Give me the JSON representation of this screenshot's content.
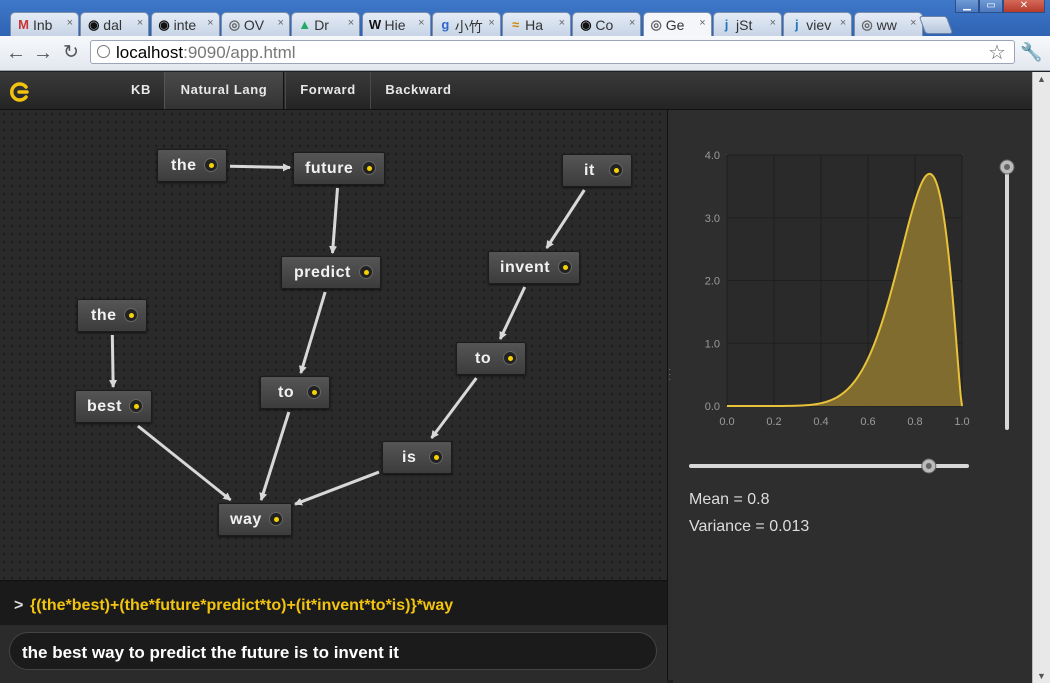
{
  "browser": {
    "tabs": [
      {
        "label": "Inb",
        "icon": "M",
        "color": "#c33"
      },
      {
        "label": "dal",
        "icon": "◉",
        "color": "#111"
      },
      {
        "label": "inte",
        "icon": "◉",
        "color": "#111"
      },
      {
        "label": "OV",
        "icon": "◎",
        "color": "#666"
      },
      {
        "label": "Dr",
        "icon": "▲",
        "color": "#2a6"
      },
      {
        "label": "Hie",
        "icon": "W",
        "color": "#111"
      },
      {
        "label": "小竹",
        "icon": "g",
        "color": "#36c"
      },
      {
        "label": "Ha",
        "icon": "≈",
        "color": "#c80"
      },
      {
        "label": "Co",
        "icon": "◉",
        "color": "#111"
      },
      {
        "label": "Ge",
        "icon": "◎",
        "color": "#666",
        "active": true
      },
      {
        "label": "jSt",
        "icon": "j",
        "color": "#27b"
      },
      {
        "label": "viev",
        "icon": "j",
        "color": "#27b"
      },
      {
        "label": "ww",
        "icon": "◎",
        "color": "#666"
      }
    ],
    "url_host": "localhost",
    "url_rest": ":9090/app.html"
  },
  "nav": {
    "tabs": [
      "KB",
      "Natural Lang",
      "Forward",
      "Backward"
    ],
    "active": "Natural Lang",
    "accent": "#f2c40f"
  },
  "graph": {
    "nodes": [
      {
        "id": "the1",
        "label": "the"
      },
      {
        "id": "future",
        "label": "future"
      },
      {
        "id": "it",
        "label": "it"
      },
      {
        "id": "predict",
        "label": "predict"
      },
      {
        "id": "invent",
        "label": "invent"
      },
      {
        "id": "the2",
        "label": "the"
      },
      {
        "id": "to2",
        "label": "to"
      },
      {
        "id": "best",
        "label": "best"
      },
      {
        "id": "to1",
        "label": "to"
      },
      {
        "id": "is",
        "label": "is"
      },
      {
        "id": "way",
        "label": "way"
      }
    ],
    "edges": [
      [
        "the1",
        "future"
      ],
      [
        "future",
        "predict"
      ],
      [
        "predict",
        "to1"
      ],
      [
        "to1",
        "way"
      ],
      [
        "it",
        "invent"
      ],
      [
        "invent",
        "to2"
      ],
      [
        "to2",
        "is"
      ],
      [
        "is",
        "way"
      ],
      [
        "the2",
        "best"
      ],
      [
        "best",
        "way"
      ]
    ]
  },
  "expression": {
    "prompt": ">",
    "text": "{(the*best)+(the*future*predict*to)+(it*invent*to*is)}*way"
  },
  "input": {
    "sentence": "the best way to predict the future is to invent it"
  },
  "chart_data": {
    "type": "area",
    "title": "",
    "xlabel": "",
    "ylabel": "",
    "xlim": [
      0,
      1
    ],
    "ylim": [
      0,
      4
    ],
    "xticks": [
      "0.0",
      "0.2",
      "0.4",
      "0.6",
      "0.8",
      "1.0"
    ],
    "yticks": [
      "0.0",
      "1.0",
      "2.0",
      "3.0",
      "4.0"
    ],
    "grid": true,
    "series": [
      {
        "distribution": "beta",
        "alpha": 9.3,
        "beta": 2.33,
        "peak": {
          "x": 0.86,
          "y": 3.7
        },
        "color": "#e8c23a",
        "fill": "#8a7330"
      }
    ]
  },
  "stats": {
    "mean_label": "Mean = 0.8",
    "variance_label": "Variance = 0.013"
  },
  "sliders": {
    "horizontal_value": 0.8,
    "vertical_value": 0.013
  }
}
